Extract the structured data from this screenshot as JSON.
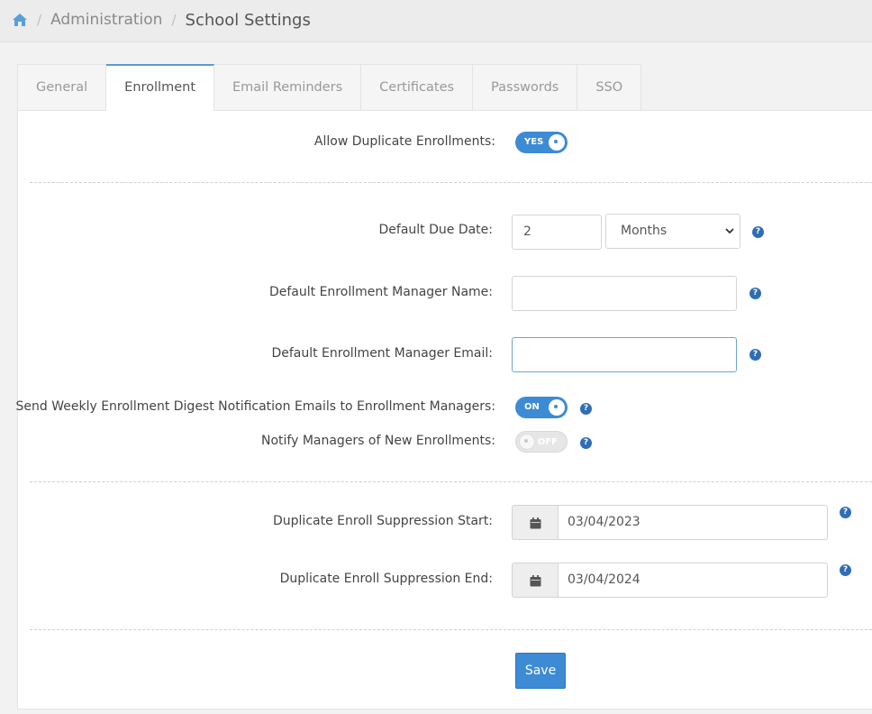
{
  "breadcrumb": {
    "parent": "Administration",
    "current": "School Settings",
    "separator": "/"
  },
  "tabs": [
    {
      "label": "General",
      "active": false
    },
    {
      "label": "Enrollment",
      "active": true
    },
    {
      "label": "Email Reminders",
      "active": false
    },
    {
      "label": "Certificates",
      "active": false
    },
    {
      "label": "Passwords",
      "active": false
    },
    {
      "label": "SSO",
      "active": false
    }
  ],
  "form": {
    "allow_duplicate": {
      "label": "Allow Duplicate Enrollments:",
      "toggle_text": "YES",
      "enabled": true
    },
    "due_date": {
      "label": "Default Due Date:",
      "value": "2",
      "unit": "Months"
    },
    "manager_name": {
      "label": "Default Enrollment Manager Name:",
      "value": ""
    },
    "manager_email": {
      "label": "Default Enrollment Manager Email:",
      "value": ""
    },
    "weekly_digest": {
      "label": "Send Weekly Enrollment Digest Notification Emails to Enrollment Managers:",
      "toggle_text": "ON",
      "enabled": true
    },
    "notify_managers": {
      "label": "Notify Managers of New Enrollments:",
      "toggle_text": "OFF",
      "enabled": false
    },
    "suppression_start": {
      "label": "Duplicate Enroll Suppression Start:",
      "value": "03/04/2023"
    },
    "suppression_end": {
      "label": "Duplicate Enroll Suppression End:",
      "value": "03/04/2024"
    },
    "help_glyph": "?"
  },
  "save_label": "Save",
  "colors": {
    "accent": "#3d8bd4",
    "help": "#2f6eb5"
  }
}
